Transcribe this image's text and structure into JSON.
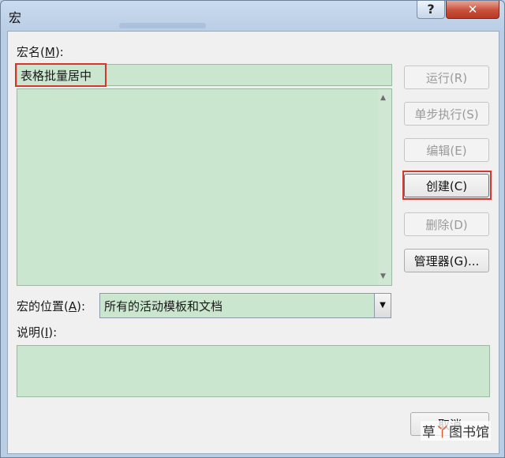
{
  "window": {
    "title": "宏",
    "help_glyph": "?",
    "close_glyph": "✕"
  },
  "macro_name": {
    "label_prefix": "宏名(",
    "label_key": "M",
    "label_suffix": "):",
    "value": "表格批量居中"
  },
  "buttons": {
    "run": "运行(R)",
    "step_into": "单步执行(S)",
    "edit": "编辑(E)",
    "create": "创建(C)",
    "delete": "删除(D)",
    "organizer": "管理器(G)..."
  },
  "location": {
    "label_prefix": "宏的位置(",
    "label_key": "A",
    "label_suffix": "):",
    "value": "所有的活动模板和文档"
  },
  "description": {
    "label_prefix": "说明(",
    "label_key": "I",
    "label_suffix": "):",
    "value": ""
  },
  "cancel": "取消",
  "watermark": {
    "part1": "草",
    "part2": "丫",
    "part3": "图书馆"
  },
  "colors": {
    "field_bg": "#cae6cf",
    "highlight": "#d7362f"
  }
}
